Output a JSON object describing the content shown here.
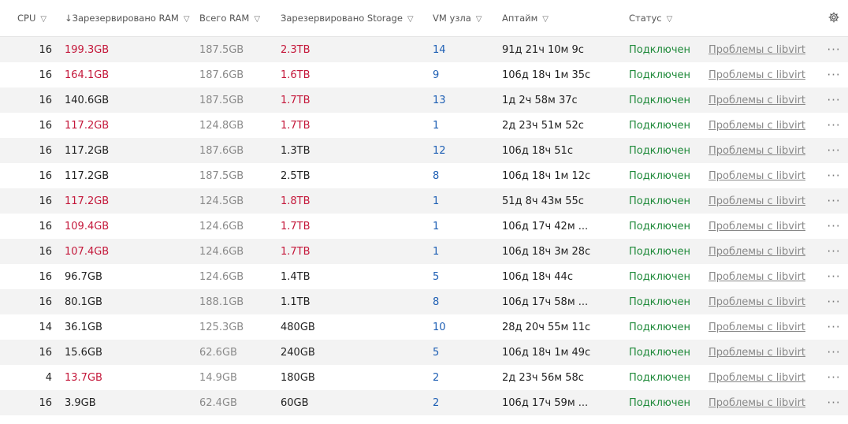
{
  "columns": {
    "cpu": "CPU",
    "reserved_ram": "↓Зарезервировано RAM",
    "total_ram": "Всего RAM",
    "reserved_storage": "Зарезервировано Storage",
    "vm": "VM узла",
    "uptime": "Аптайм",
    "status": "Статус"
  },
  "icons": {
    "filter": "filter-icon",
    "settings": "gear-icon",
    "actions": "more-dots-icon"
  },
  "colors": {
    "warning": "#c4173a",
    "ok": "#1f8a3a",
    "link": "#1e5fb4"
  },
  "rows": [
    {
      "cpu": "16",
      "reserved_ram": "199.3GB",
      "ram_warn": true,
      "total_ram": "187.5GB",
      "reserved_storage": "2.3TB",
      "stor_warn": true,
      "vm": "14",
      "uptime": "91д 21ч 10м 9с",
      "status": "Подключен",
      "problem": "Проблемы с libvirt"
    },
    {
      "cpu": "16",
      "reserved_ram": "164.1GB",
      "ram_warn": true,
      "total_ram": "187.6GB",
      "reserved_storage": "1.6TB",
      "stor_warn": true,
      "vm": "9",
      "uptime": "106д 18ч 1м 35с",
      "status": "Подключен",
      "problem": "Проблемы с libvirt"
    },
    {
      "cpu": "16",
      "reserved_ram": "140.6GB",
      "ram_warn": false,
      "total_ram": "187.5GB",
      "reserved_storage": "1.7TB",
      "stor_warn": true,
      "vm": "13",
      "uptime": "1д 2ч 58м 37с",
      "status": "Подключен",
      "problem": "Проблемы с libvirt"
    },
    {
      "cpu": "16",
      "reserved_ram": "117.2GB",
      "ram_warn": true,
      "total_ram": "124.8GB",
      "reserved_storage": "1.7TB",
      "stor_warn": true,
      "vm": "1",
      "uptime": "2д 23ч 51м 52с",
      "status": "Подключен",
      "problem": "Проблемы с libvirt"
    },
    {
      "cpu": "16",
      "reserved_ram": "117.2GB",
      "ram_warn": false,
      "total_ram": "187.6GB",
      "reserved_storage": "1.3TB",
      "stor_warn": false,
      "vm": "12",
      "uptime": "106д 18ч 51с",
      "status": "Подключен",
      "problem": "Проблемы с libvirt"
    },
    {
      "cpu": "16",
      "reserved_ram": "117.2GB",
      "ram_warn": false,
      "total_ram": "187.5GB",
      "reserved_storage": "2.5TB",
      "stor_warn": false,
      "vm": "8",
      "uptime": "106д 18ч 1м 12с",
      "status": "Подключен",
      "problem": "Проблемы с libvirt"
    },
    {
      "cpu": "16",
      "reserved_ram": "117.2GB",
      "ram_warn": true,
      "total_ram": "124.5GB",
      "reserved_storage": "1.8TB",
      "stor_warn": true,
      "vm": "1",
      "uptime": "51д 8ч 43м 55с",
      "status": "Подключен",
      "problem": "Проблемы с libvirt"
    },
    {
      "cpu": "16",
      "reserved_ram": "109.4GB",
      "ram_warn": true,
      "total_ram": "124.6GB",
      "reserved_storage": "1.7TB",
      "stor_warn": true,
      "vm": "1",
      "uptime": "106д 17ч 42м ...",
      "status": "Подключен",
      "problem": "Проблемы с libvirt"
    },
    {
      "cpu": "16",
      "reserved_ram": "107.4GB",
      "ram_warn": true,
      "total_ram": "124.6GB",
      "reserved_storage": "1.7TB",
      "stor_warn": true,
      "vm": "1",
      "uptime": "106д 18ч 3м 28с",
      "status": "Подключен",
      "problem": "Проблемы с libvirt"
    },
    {
      "cpu": "16",
      "reserved_ram": "96.7GB",
      "ram_warn": false,
      "total_ram": "124.6GB",
      "reserved_storage": "1.4TB",
      "stor_warn": false,
      "vm": "5",
      "uptime": "106д 18ч 44с",
      "status": "Подключен",
      "problem": "Проблемы с libvirt"
    },
    {
      "cpu": "16",
      "reserved_ram": "80.1GB",
      "ram_warn": false,
      "total_ram": "188.1GB",
      "reserved_storage": "1.1TB",
      "stor_warn": false,
      "vm": "8",
      "uptime": "106д 17ч 58м ...",
      "status": "Подключен",
      "problem": "Проблемы с libvirt"
    },
    {
      "cpu": "14",
      "reserved_ram": "36.1GB",
      "ram_warn": false,
      "total_ram": "125.3GB",
      "reserved_storage": "480GB",
      "stor_warn": false,
      "vm": "10",
      "uptime": "28д 20ч 55м 11с",
      "status": "Подключен",
      "problem": "Проблемы с libvirt"
    },
    {
      "cpu": "16",
      "reserved_ram": "15.6GB",
      "ram_warn": false,
      "total_ram": "62.6GB",
      "reserved_storage": "240GB",
      "stor_warn": false,
      "vm": "5",
      "uptime": "106д 18ч 1м 49с",
      "status": "Подключен",
      "problem": "Проблемы с libvirt"
    },
    {
      "cpu": "4",
      "reserved_ram": "13.7GB",
      "ram_warn": true,
      "total_ram": "14.9GB",
      "reserved_storage": "180GB",
      "stor_warn": false,
      "vm": "2",
      "uptime": "2д 23ч 56м 58с",
      "status": "Подключен",
      "problem": "Проблемы с libvirt"
    },
    {
      "cpu": "16",
      "reserved_ram": "3.9GB",
      "ram_warn": false,
      "total_ram": "62.4GB",
      "reserved_storage": "60GB",
      "stor_warn": false,
      "vm": "2",
      "uptime": "106д 17ч 59м ...",
      "status": "Подключен",
      "problem": "Проблемы с libvirt"
    }
  ]
}
